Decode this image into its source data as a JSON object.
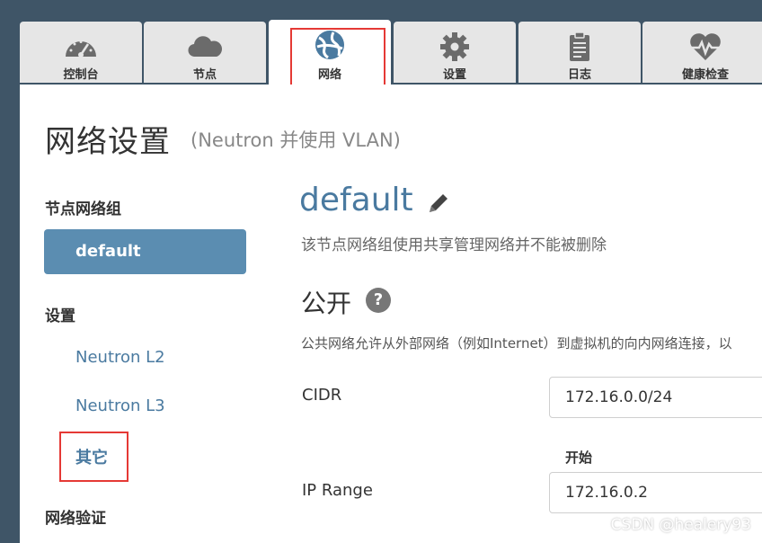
{
  "tabs": [
    {
      "label": "控制台",
      "icon": "dashboard-gauge-icon"
    },
    {
      "label": "节点",
      "icon": "cloud-icon"
    },
    {
      "label": "网络",
      "icon": "globe-network-icon",
      "active": true
    },
    {
      "label": "设置",
      "icon": "gear-icon"
    },
    {
      "label": "日志",
      "icon": "clipboard-log-icon"
    },
    {
      "label": "健康检查",
      "icon": "heart-pulse-icon"
    }
  ],
  "page": {
    "title": "网络设置",
    "subtitle": "(Neutron 并使用 VLAN)"
  },
  "sidebar": {
    "group_heading": "节点网络组",
    "group_button": "default",
    "settings_heading": "设置",
    "links": [
      "Neutron L2",
      "Neutron L3",
      "其它"
    ],
    "verify_heading": "网络验证"
  },
  "network": {
    "name": "default",
    "edit_icon": "pencil-icon",
    "description": "该节点网络组使用共享管理网络并不能被删除"
  },
  "public": {
    "title": "公开",
    "help_icon": "question-icon",
    "help_glyph": "?",
    "description": "公共网络允许从外部网络（例如Internet）到虚拟机的向内网络连接，以",
    "cidr_label": "CIDR",
    "cidr_value": "172.16.0.0/24",
    "start_header": "开始",
    "ip_range_label": "IP Range",
    "ip_range_start": "172.16.0.2"
  },
  "colors": {
    "accent": "#4a7aa0",
    "button": "#5b8db1",
    "highlight": "#e53935",
    "header_bg": "#3f5567"
  },
  "watermark": "CSDN @healery93"
}
